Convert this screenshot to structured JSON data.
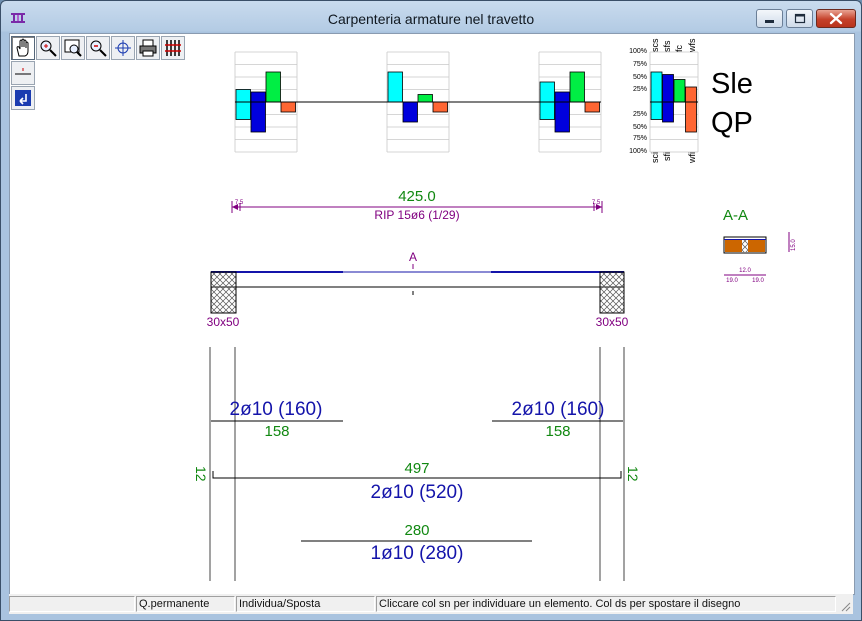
{
  "window": {
    "title": "Carpenteria armature nel travetto"
  },
  "toolbar": {
    "tools": [
      {
        "icon": "hand-pan-icon",
        "active": true
      },
      {
        "icon": "zoom-in-icon"
      },
      {
        "icon": "zoom-window-icon"
      },
      {
        "icon": "zoom-out-icon"
      },
      {
        "icon": "crosshair-target-icon"
      },
      {
        "icon": "printer-icon"
      },
      {
        "icon": "rebar-grid-icon"
      }
    ],
    "side_tools": [
      {
        "icon": "line-section-icon"
      },
      {
        "icon": "return-arrow-icon"
      }
    ]
  },
  "colors": {
    "cyan": "#00ffff",
    "blue": "#0000dd",
    "green": "#00ee44",
    "orange": "#ff6633",
    "purple": "#800080",
    "dark_green": "#118811",
    "dark_blue": "#1414aa",
    "brown": "#cc6600"
  },
  "checks": {
    "top_labels": [
      "scs",
      "sfs",
      "fc",
      "wfs"
    ],
    "bottom_labels": [
      "sci",
      "sfi",
      "wfi"
    ],
    "pct_top": [
      "100%",
      "75%",
      "50%",
      "25%"
    ],
    "pct_bottom": [
      "25%",
      "50%",
      "75%",
      "100%"
    ],
    "sections": [
      {
        "bars": [
          {
            "color": "cyan",
            "up": 0.25,
            "down": 0.35
          },
          {
            "color": "blue",
            "up": 0.2,
            "down": 0.6
          },
          {
            "color": "green",
            "up": 0.6,
            "down": 0
          },
          {
            "color": "orange",
            "up": 0,
            "down": 0.2
          }
        ]
      },
      {
        "bars": [
          {
            "color": "cyan",
            "up": 0.6,
            "down": 0
          },
          {
            "color": "blue",
            "up": 0,
            "down": 0.4
          },
          {
            "color": "green",
            "up": 0.15,
            "down": 0
          },
          {
            "color": "orange",
            "up": 0,
            "down": 0.2
          }
        ]
      },
      {
        "bars": [
          {
            "color": "cyan",
            "up": 0.4,
            "down": 0.35
          },
          {
            "color": "blue",
            "up": 0.2,
            "down": 0.6
          },
          {
            "color": "green",
            "up": 0.6,
            "down": 0
          },
          {
            "color": "orange",
            "up": 0,
            "down": 0.2
          }
        ]
      },
      {
        "bars": [
          {
            "color": "cyan",
            "up": 0.6,
            "down": 0.35
          },
          {
            "color": "blue",
            "up": 0.55,
            "down": 0.4
          },
          {
            "color": "green",
            "up": 0.45,
            "down": 0
          },
          {
            "color": "orange",
            "up": 0.3,
            "down": 0.6
          }
        ]
      }
    ],
    "combo": [
      "Sle",
      "QP"
    ]
  },
  "stirrups": {
    "span": "425.0",
    "text": "RIP 15ø6 (1/29)",
    "left_end": "7.5",
    "right_end": "7.5"
  },
  "section_marker": "A",
  "section_detail": {
    "title": "A-A",
    "height": "15.0",
    "rib": "12.0",
    "left": "19.0",
    "right": "19.0"
  },
  "supports": {
    "left": "30x50",
    "right": "30x50"
  },
  "bars": {
    "top_left": {
      "label": "2ø10 (160)",
      "length": "158"
    },
    "top_right": {
      "label": "2ø10 (160)",
      "length": "158"
    },
    "bottom_main": {
      "label": "2ø10 (520)",
      "length": "497",
      "hook_left": "12",
      "hook_right": "12"
    },
    "bottom_extra": {
      "label": "1ø10 (280)",
      "length": "280"
    }
  },
  "status": {
    "panel1": "",
    "panel2": "Q.permanente",
    "panel3": "Individua/Sposta",
    "panel4": "Cliccare col sn per individuare un elemento. Col ds per spostare il disegno"
  }
}
